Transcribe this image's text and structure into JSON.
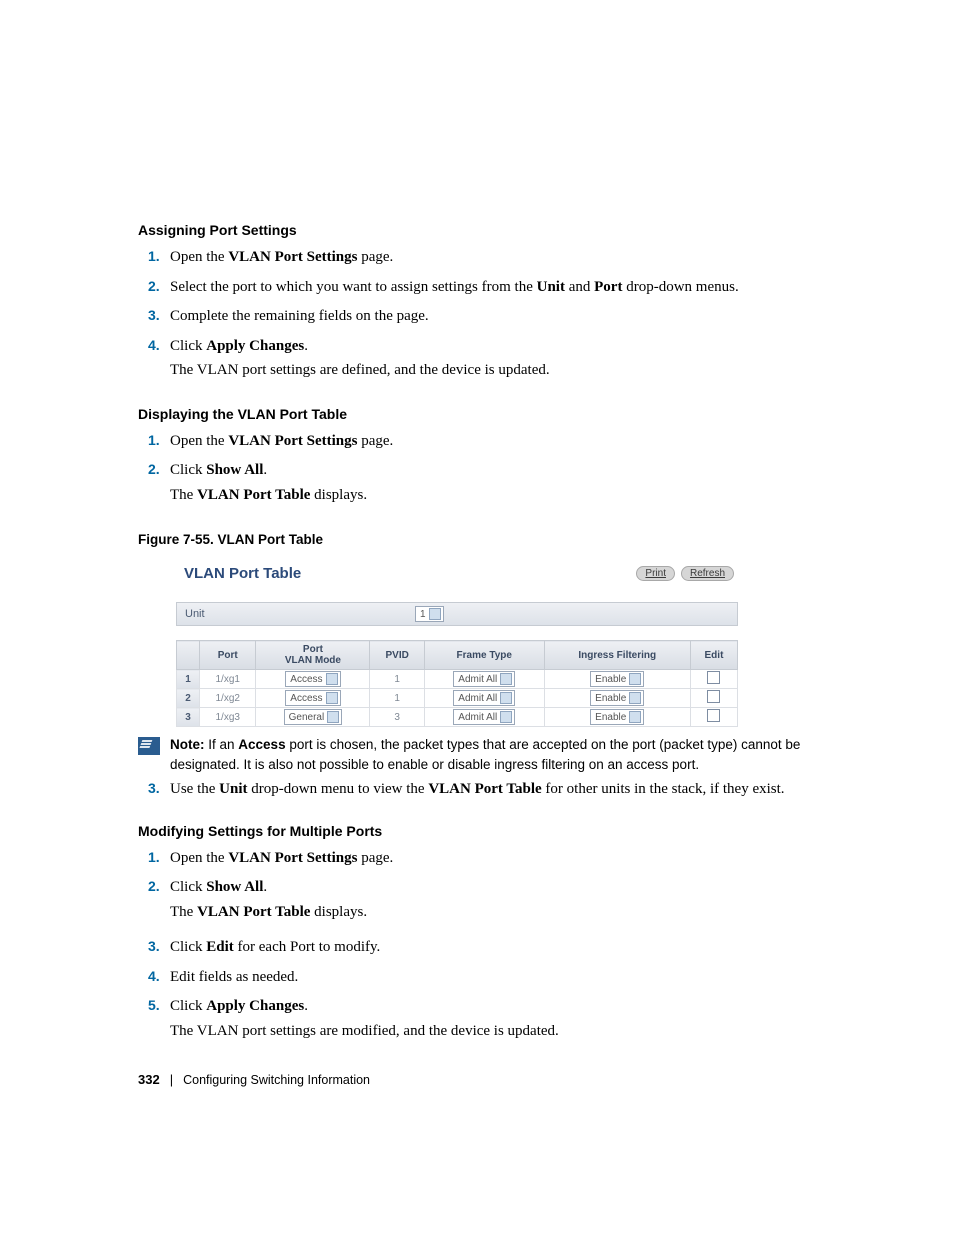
{
  "sections": {
    "assigning": {
      "heading": "Assigning Port Settings",
      "steps": [
        {
          "n": "1.",
          "pre": "Open the ",
          "b": "VLAN Port Settings",
          "post": " page."
        },
        {
          "n": "2.",
          "pre": "Select the port to which you want to assign settings from the ",
          "b": "Unit",
          "mid": " and ",
          "b2": "Port",
          "post": " drop-down menus."
        },
        {
          "n": "3.",
          "text": "Complete the remaining fields on the page."
        },
        {
          "n": "4.",
          "pre": "Click ",
          "b": "Apply Changes",
          "post": ".",
          "follow": "The VLAN port settings are defined, and the device is updated."
        }
      ]
    },
    "displaying": {
      "heading": "Displaying the VLAN Port Table",
      "steps": [
        {
          "n": "1.",
          "pre": "Open the ",
          "b": "VLAN Port Settings",
          "post": " page."
        },
        {
          "n": "2.",
          "pre": "Click ",
          "b": "Show All",
          "post": ".",
          "follow_pre": "The ",
          "follow_b": "VLAN Port Table",
          "follow_post": " displays."
        }
      ]
    },
    "modifying": {
      "heading": "Modifying Settings for Multiple Ports",
      "steps": [
        {
          "n": "1.",
          "pre": "Open the ",
          "b": "VLAN Port Settings",
          "post": " page."
        },
        {
          "n": "2.",
          "pre": "Click ",
          "b": "Show All",
          "post": ".",
          "follow_pre": "The ",
          "follow_b": "VLAN Port Table",
          "follow_post": " displays."
        },
        {
          "n": "3.",
          "pre": "Click ",
          "b": "Edit",
          "post": " for each Port to modify."
        },
        {
          "n": "4.",
          "text": "Edit fields as needed."
        },
        {
          "n": "5.",
          "pre": "Click ",
          "b": "Apply Changes",
          "post": ".",
          "follow": "The VLAN port settings are modified, and the device is updated."
        }
      ]
    }
  },
  "figure_caption": "Figure 7-55.    VLAN Port Table",
  "screenshot": {
    "title": "VLAN Port Table",
    "buttons": {
      "print": "Print",
      "refresh": "Refresh"
    },
    "unit_label": "Unit",
    "unit_value": "1",
    "headers": {
      "port": "Port",
      "mode": "Port\nVLAN Mode",
      "pvid": "PVID",
      "frame": "Frame Type",
      "ingress": "Ingress Filtering",
      "edit": "Edit"
    },
    "rows": [
      {
        "idx": "1",
        "port": "1/xg1",
        "mode": "Access",
        "pvid": "1",
        "frame": "Admit All",
        "ingress": "Enable"
      },
      {
        "idx": "2",
        "port": "1/xg2",
        "mode": "Access",
        "pvid": "1",
        "frame": "Admit All",
        "ingress": "Enable"
      },
      {
        "idx": "3",
        "port": "1/xg3",
        "mode": "General",
        "pvid": "3",
        "frame": "Admit All",
        "ingress": "Enable"
      }
    ]
  },
  "note": {
    "label": "Note:",
    "text_pre": " If an ",
    "bold": "Access",
    "text_post": " port is chosen, the packet types that are accepted on the port (packet type) cannot be designated. It is also not possible to enable or disable ingress filtering on an access port."
  },
  "step3_after_note": {
    "n": "3.",
    "pre": "Use the ",
    "b": "Unit",
    "mid": " drop-down menu to view the ",
    "b2": "VLAN Port Table",
    "post": " for other units in the stack, if they exist."
  },
  "footer": {
    "page": "332",
    "section": "Configuring Switching Information"
  }
}
